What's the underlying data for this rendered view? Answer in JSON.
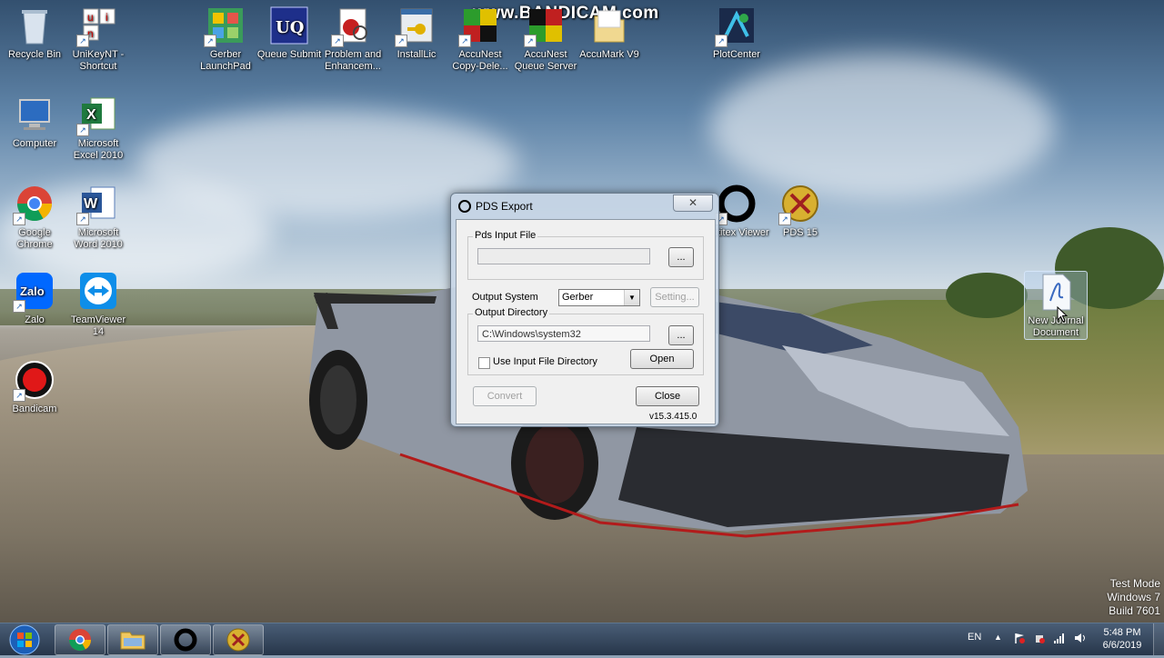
{
  "watermark": "www.BANDICAM.com",
  "desktop_icons": [
    {
      "label": "Recycle Bin",
      "icon": "recycle-bin-icon"
    },
    {
      "label": "UniKeyNT - Shortcut",
      "icon": "unikey-icon"
    },
    {
      "label": "Gerber LaunchPad",
      "icon": "gerber-launchpad-icon"
    },
    {
      "label": "Queue Submit",
      "icon": "uq-icon"
    },
    {
      "label": "Problem and Enhancem...",
      "icon": "problem-report-icon"
    },
    {
      "label": "InstallLic",
      "icon": "install-license-icon"
    },
    {
      "label": "AccuNest Copy-Dele...",
      "icon": "accunest-icon"
    },
    {
      "label": "AccuNest Queue Server",
      "icon": "accunest-queue-icon"
    },
    {
      "label": "AccuMark V9",
      "icon": "folder-icon"
    },
    {
      "label": "PlotCenter",
      "icon": "plotcenter-icon"
    },
    {
      "label": "Computer",
      "icon": "computer-icon"
    },
    {
      "label": "Microsoft Excel 2010",
      "icon": "excel-icon"
    },
    {
      "label": "Google Chrome",
      "icon": "chrome-icon"
    },
    {
      "label": "Microsoft Word 2010",
      "icon": "word-icon"
    },
    {
      "label": "Zalo",
      "icon": "zalo-icon"
    },
    {
      "label": "TeamViewer 14",
      "icon": "teamviewer-icon"
    },
    {
      "label": "Bandicam",
      "icon": "bandicam-icon"
    },
    {
      "label": "Optitex Viewer",
      "icon": "optitex-icon"
    },
    {
      "label": "PDS 15",
      "icon": "pds-icon"
    },
    {
      "label": "New Journal Document",
      "icon": "journal-document-icon"
    }
  ],
  "dialog": {
    "title": "PDS Export",
    "close_glyph": "✕",
    "input_group_label": "Pds Input File",
    "input_file_value": "",
    "browse_label": "...",
    "output_system_label": "Output System",
    "output_system_value": "Gerber",
    "setting_label": "Setting...",
    "output_dir_group_label": "Output Directory",
    "output_dir_value": "C:\\Windows\\system32",
    "use_input_dir_label": "Use Input File Directory",
    "use_input_dir_checked": false,
    "open_label": "Open",
    "convert_label": "Convert",
    "close_label": "Close",
    "version": "v15.3.415.0"
  },
  "system": {
    "test_mode": "Test Mode",
    "os_name": "Windows 7",
    "build": "Build 7601",
    "language": "EN",
    "time": "5:48 PM",
    "date": "6/6/2019"
  },
  "colors": {
    "taskbar": "#2f4561",
    "dialog_frame": "#c8d6e6",
    "dialog_body": "#f0f0f0"
  }
}
